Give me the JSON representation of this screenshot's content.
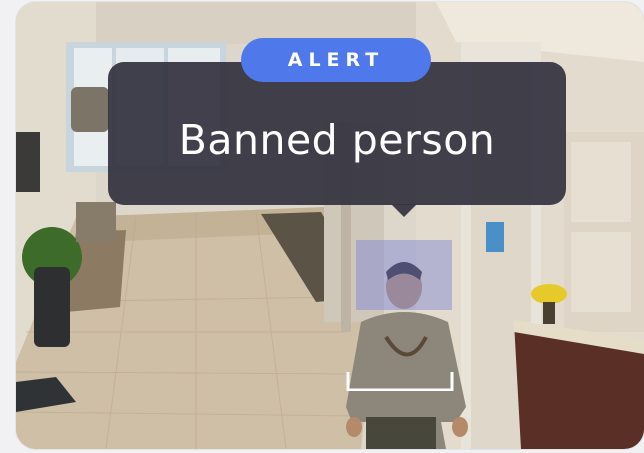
{
  "alert": {
    "badge_label": "ALERT",
    "message": "Banned person"
  },
  "colors": {
    "badge_bg": "#4f78ea",
    "bubble_bg": "#34333f",
    "detection_box": "#ffffff",
    "detection_fill": "#7a86d6"
  },
  "icons": {
    "caret": "speech-bubble-pointer-icon"
  }
}
